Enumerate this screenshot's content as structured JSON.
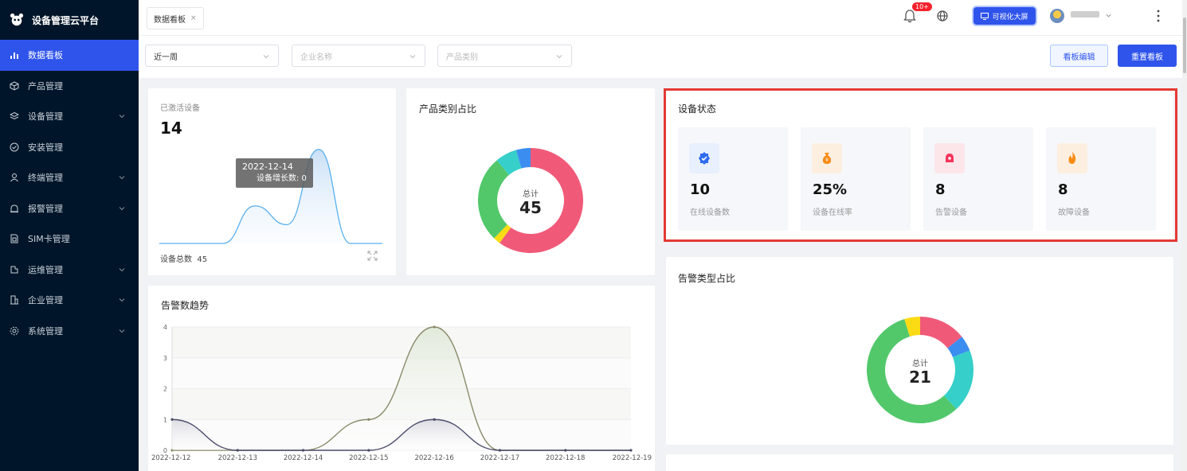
{
  "app": {
    "title": "设备管理云平台"
  },
  "sidebar": {
    "items": [
      {
        "label": "数据看板",
        "icon": "bar-chart-icon",
        "active": true,
        "expandable": false
      },
      {
        "label": "产品管理",
        "icon": "cube-icon",
        "active": false,
        "expandable": false
      },
      {
        "label": "设备管理",
        "icon": "layers-icon",
        "active": false,
        "expandable": true
      },
      {
        "label": "安装管理",
        "icon": "check-circle-icon",
        "active": false,
        "expandable": false
      },
      {
        "label": "终端管理",
        "icon": "user-icon",
        "active": false,
        "expandable": true
      },
      {
        "label": "报警管理",
        "icon": "alarm-icon",
        "active": false,
        "expandable": true
      },
      {
        "label": "SIM卡管理",
        "icon": "sim-card-icon",
        "active": false,
        "expandable": false
      },
      {
        "label": "运维管理",
        "icon": "tool-icon",
        "active": false,
        "expandable": true
      },
      {
        "label": "企业管理",
        "icon": "building-icon",
        "active": false,
        "expandable": true
      },
      {
        "label": "系统管理",
        "icon": "gear-icon",
        "active": false,
        "expandable": true
      }
    ]
  },
  "header": {
    "tab_label": "数据看板",
    "tab_close": "×",
    "notification_badge": "10+",
    "screen_button": "可视化大屏"
  },
  "filters": {
    "period": "近一周",
    "company_placeholder": "企业名称",
    "category_placeholder": "产品类别",
    "edit_button": "看板编辑",
    "reset_button": "重置看板"
  },
  "activated": {
    "label": "已激活设备",
    "value": "14",
    "total_label": "设备总数",
    "total_value": "45",
    "tooltip_date": "2022-12-14",
    "tooltip_text": "设备增长数: 0"
  },
  "product_share": {
    "title": "产品类别占比",
    "total_label": "总计",
    "total_value": "45"
  },
  "device_status": {
    "title": "设备状态",
    "items": [
      {
        "value": "10",
        "label": "在线设备数",
        "icon": "verified-badge-icon",
        "color": "#2f6bf0",
        "bg": "#e8effd"
      },
      {
        "value": "25%",
        "label": "设备在线率",
        "icon": "money-bag-icon",
        "color": "#fa8c16",
        "bg": "#fdefe0"
      },
      {
        "value": "8",
        "label": "告警设备",
        "icon": "alarm-bell-icon",
        "color": "#f5365c",
        "bg": "#fde6ea"
      },
      {
        "value": "8",
        "label": "故障设备",
        "icon": "fire-icon",
        "color": "#fa8c16",
        "bg": "#fdefe0"
      }
    ]
  },
  "alarm_share": {
    "title": "告警类型占比",
    "total_label": "总计",
    "total_value": "21"
  },
  "alarm_trend": {
    "title": "告警数趋势"
  },
  "colors": {
    "accent": "#2f54eb",
    "sidebar_bg": "#001529",
    "highlight": "#e53935"
  },
  "chart_data": [
    {
      "type": "area",
      "title": "已激活设备",
      "x": [
        "2022-12-12",
        "2022-12-13",
        "2022-12-14",
        "2022-12-15",
        "2022-12-16",
        "2022-12-17",
        "2022-12-18",
        "2022-12-19"
      ],
      "series": [
        {
          "values": [
            0,
            0,
            0,
            2,
            1,
            5,
            0,
            0
          ]
        }
      ]
    },
    {
      "type": "pie",
      "title": "产品类别占比",
      "slices": [
        {
          "value": 27,
          "color": "#f05a78"
        },
        {
          "value": 1,
          "color": "#fadb14"
        },
        {
          "value": 12,
          "color": "#52c86b"
        },
        {
          "value": 3,
          "color": "#36cfc9"
        },
        {
          "value": 2,
          "color": "#3b8ef0"
        }
      ]
    },
    {
      "type": "pie",
      "title": "告警类型占比",
      "slices": [
        {
          "value": 3,
          "color": "#f05a78"
        },
        {
          "value": 1,
          "color": "#3b8ef0"
        },
        {
          "value": 4,
          "color": "#36cfc9"
        },
        {
          "value": 12,
          "color": "#52c86b"
        },
        {
          "value": 1,
          "color": "#fadb14"
        }
      ]
    },
    {
      "type": "area",
      "title": "告警数趋势",
      "x": [
        "2022-12-12",
        "2022-12-13",
        "2022-12-14",
        "2022-12-15",
        "2022-12-16",
        "2022-12-17",
        "2022-12-18",
        "2022-12-19"
      ],
      "y_ticks": [
        "0",
        "1",
        "2",
        "3",
        "4"
      ],
      "ylim": [
        0,
        4
      ],
      "series": [
        {
          "values": [
            1,
            0,
            0,
            0,
            1,
            0,
            0,
            0
          ],
          "color": "#4a4a6a"
        },
        {
          "values": [
            0,
            0,
            0,
            1,
            4,
            0,
            0,
            0
          ],
          "color": "#8a8a6a"
        }
      ]
    }
  ]
}
